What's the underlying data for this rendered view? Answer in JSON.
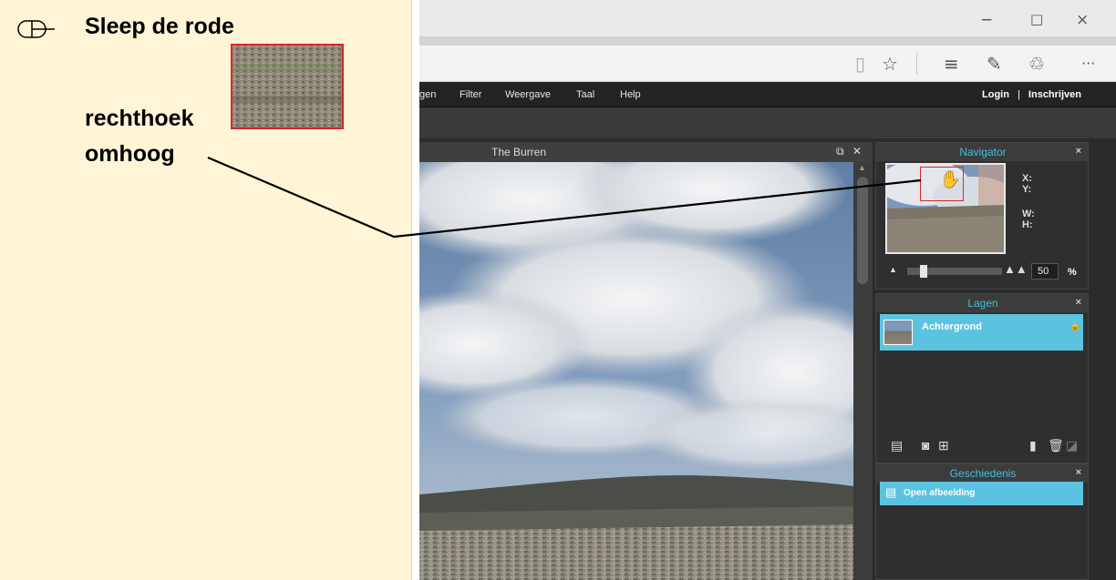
{
  "instruction": {
    "line1": "Sleep de rode",
    "line2": "rechthoek",
    "line3": "omhoog"
  },
  "browser": {
    "window_controls": {
      "minimize": "−",
      "maximize": "□",
      "close": "×"
    },
    "address_icons": {
      "reading_view": "▯",
      "favorite": "☆",
      "hub": "≡",
      "notes": "✎",
      "share": "♲",
      "more": "···"
    }
  },
  "editor": {
    "menu": [
      "gen",
      "Filter",
      "Weergave",
      "Taal",
      "Help"
    ],
    "auth": {
      "login": "Login",
      "separator": "|",
      "register": "Inschrijven"
    },
    "document": {
      "title": "The Burren",
      "popout": "⧉",
      "close": "✕"
    },
    "navigator": {
      "title": "Navigator",
      "close": "×",
      "x_label": "X:",
      "y_label": "Y:",
      "w_label": "W:",
      "h_label": "H:",
      "zoom_value": "50",
      "zoom_unit": "%",
      "zoom_fraction": 0.15
    },
    "layers": {
      "title": "Lagen",
      "close": "×",
      "items": [
        {
          "name": "Achtergrond",
          "locked_icon": "🔒"
        }
      ]
    },
    "history": {
      "title": "Geschiedenis",
      "close": "×",
      "items": [
        "Open afbeelding"
      ]
    }
  },
  "colors": {
    "accent": "#3fc0de",
    "highlight_row": "#5bc3df",
    "instruction_bg": "#fff4d6",
    "marker_red": "#d8262b"
  }
}
